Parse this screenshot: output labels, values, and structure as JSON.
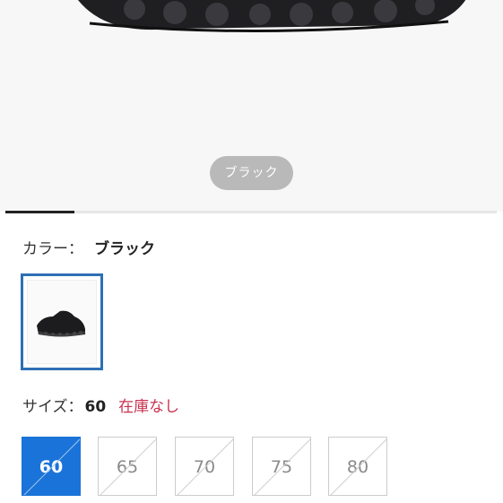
{
  "hero": {
    "color_chip_label": "ブラック",
    "image_description_icon": "shoe-sole-icon",
    "gallery_progress": 0.14
  },
  "color_option": {
    "label": "カラー：",
    "value": "ブラック",
    "swatch_icon": "shoe-thumbnail-icon"
  },
  "size_option": {
    "label": "サイズ：",
    "value": "60",
    "stock_status": "在庫なし"
  },
  "sizes": [
    "60",
    "65",
    "70",
    "75",
    "80"
  ],
  "colors": {
    "selected_size_bg": "#1a73d9",
    "stock_out_text": "#c9314f",
    "swatch_border": "#2f6fb6"
  }
}
